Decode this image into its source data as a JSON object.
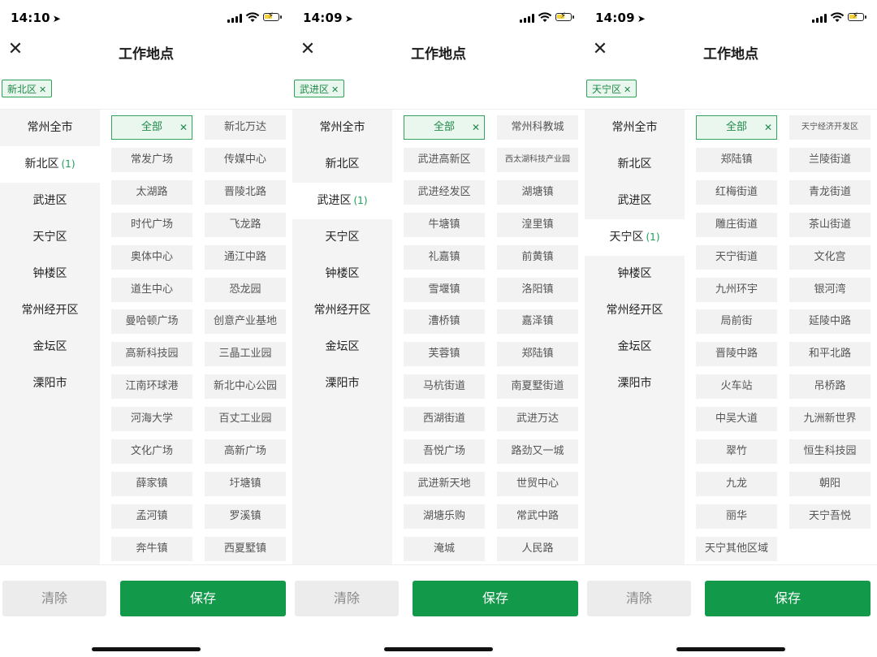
{
  "screens": [
    {
      "time": "14:10",
      "title": "工作地点",
      "selected_chip": "新北区",
      "left_items": [
        {
          "label": "常州全市",
          "count": "",
          "active": false
        },
        {
          "label": "新北区",
          "count": "(1)",
          "active": true
        },
        {
          "label": "武进区",
          "count": "",
          "active": false
        },
        {
          "label": "天宁区",
          "count": "",
          "active": false
        },
        {
          "label": "钟楼区",
          "count": "",
          "active": false
        },
        {
          "label": "常州经开区",
          "count": "",
          "active": false
        },
        {
          "label": "金坛区",
          "count": "",
          "active": false
        },
        {
          "label": "溧阳市",
          "count": "",
          "active": false
        }
      ],
      "cells": [
        "全部",
        "新北万达",
        "常发广场",
        "传媒中心",
        "太湖路",
        "晋陵北路",
        "时代广场",
        "飞龙路",
        "奥体中心",
        "通江中路",
        "道生中心",
        "恐龙园",
        "曼哈顿广场",
        "创意产业基地",
        "高新科技园",
        "三晶工业园",
        "江南环球港",
        "新北中心公园",
        "河海大学",
        "百丈工业园",
        "文化广场",
        "高新广场",
        "薛家镇",
        "圩塘镇",
        "孟河镇",
        "罗溪镇",
        "奔牛镇",
        "西夏墅镇"
      ],
      "clear_label": "清除",
      "save_label": "保存"
    },
    {
      "time": "14:09",
      "title": "工作地点",
      "selected_chip": "武进区",
      "left_items": [
        {
          "label": "常州全市",
          "count": "",
          "active": false
        },
        {
          "label": "新北区",
          "count": "",
          "active": false
        },
        {
          "label": "武进区",
          "count": "(1)",
          "active": true
        },
        {
          "label": "天宁区",
          "count": "",
          "active": false
        },
        {
          "label": "钟楼区",
          "count": "",
          "active": false
        },
        {
          "label": "常州经开区",
          "count": "",
          "active": false
        },
        {
          "label": "金坛区",
          "count": "",
          "active": false
        },
        {
          "label": "溧阳市",
          "count": "",
          "active": false
        }
      ],
      "cells": [
        "全部",
        "常州科教城",
        "武进高新区",
        "西太湖科技产业园",
        "武进经发区",
        "湖塘镇",
        "牛塘镇",
        "湟里镇",
        "礼嘉镇",
        "前黄镇",
        "雪堰镇",
        "洛阳镇",
        "漕桥镇",
        "嘉泽镇",
        "芙蓉镇",
        "郑陆镇",
        "马杭街道",
        "南夏墅街道",
        "西湖街道",
        "武进万达",
        "吾悦广场",
        "路劲又一城",
        "武进新天地",
        "世贸中心",
        "湖塘乐购",
        "常武中路",
        "淹城",
        "人民路"
      ],
      "clear_label": "清除",
      "save_label": "保存"
    },
    {
      "time": "14:09",
      "title": "工作地点",
      "selected_chip": "天宁区",
      "left_items": [
        {
          "label": "常州全市",
          "count": "",
          "active": false
        },
        {
          "label": "新北区",
          "count": "",
          "active": false
        },
        {
          "label": "武进区",
          "count": "",
          "active": false
        },
        {
          "label": "天宁区",
          "count": "(1)",
          "active": true
        },
        {
          "label": "钟楼区",
          "count": "",
          "active": false
        },
        {
          "label": "常州经开区",
          "count": "",
          "active": false
        },
        {
          "label": "金坛区",
          "count": "",
          "active": false
        },
        {
          "label": "溧阳市",
          "count": "",
          "active": false
        }
      ],
      "cells": [
        "全部",
        "天宁经济开发区",
        "郑陆镇",
        "兰陵街道",
        "红梅街道",
        "青龙街道",
        "雕庄街道",
        "茶山街道",
        "天宁街道",
        "文化宫",
        "九州环宇",
        "银河湾",
        "局前街",
        "延陵中路",
        "晋陵中路",
        "和平北路",
        "火车站",
        "吊桥路",
        "中吴大道",
        "九洲新世界",
        "翠竹",
        "恒生科技园",
        "九龙",
        "朝阳",
        "丽华",
        "天宁吾悦",
        "天宁其他区域"
      ],
      "clear_label": "清除",
      "save_label": "保存"
    }
  ],
  "colors": {
    "accent": "#12994a",
    "chip_bg": "#eaf7ee",
    "chip_border": "#2ea05a"
  }
}
